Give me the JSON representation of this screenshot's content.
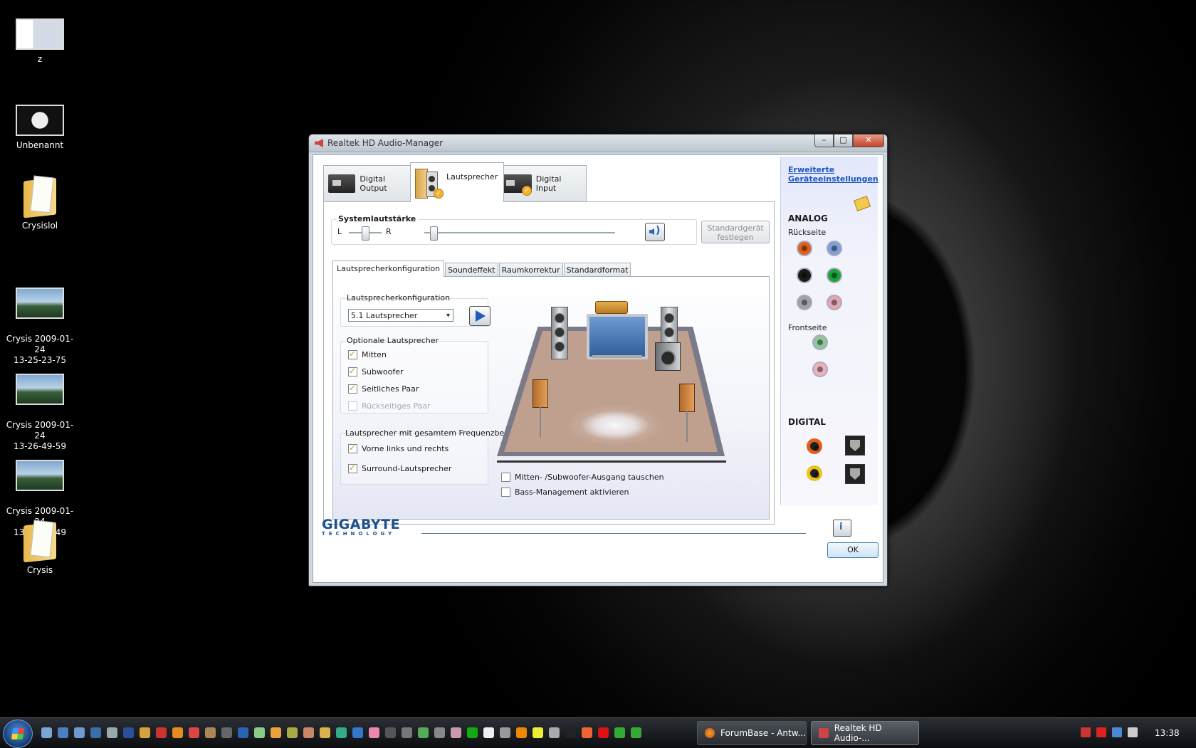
{
  "desktop": {
    "icons": [
      {
        "label": "z"
      },
      {
        "label": "Unbenannt"
      },
      {
        "label": "Crysislol"
      },
      {
        "label": "Crysis 2009-01-24\n13-25-23-75"
      },
      {
        "label": "Crysis 2009-01-24\n13-26-49-59"
      },
      {
        "label": "Crysis 2009-01-24\n13-26-50-49"
      },
      {
        "label": "Crysis"
      }
    ]
  },
  "window": {
    "title": "Realtek HD Audio-Manager",
    "buttons": {
      "minimize": "–",
      "maximize": "□",
      "close": "✕"
    }
  },
  "device_tabs": [
    {
      "label": "Digital Output",
      "icon": "sound-card-icon",
      "active": false
    },
    {
      "label": "Lautsprecher",
      "icon": "speaker-icon",
      "active": true
    },
    {
      "label": "Digital Input",
      "icon": "sound-card-input-icon",
      "active": false
    }
  ],
  "volume": {
    "title": "Systemlautstärke",
    "left_label": "L",
    "right_label": "R",
    "balance_level": 0.5,
    "volume_level": 0.05,
    "mute_icon": "speaker-volume-icon",
    "default_device_button": "Standardgerät\nfestlegen"
  },
  "sub_tabs": [
    {
      "label": "Lautsprecherkonfiguration",
      "active": true
    },
    {
      "label": "Soundeffekt",
      "active": false
    },
    {
      "label": "Raumkorrektur",
      "active": false
    },
    {
      "label": "Standardformat",
      "active": false
    }
  ],
  "config": {
    "group_title": "Lautsprecherkonfiguration",
    "selected": "5.1 Lautsprecher",
    "play_icon": "play-icon"
  },
  "optional": {
    "title": "Optionale Lautsprecher",
    "items": [
      {
        "label": "Mitten",
        "checked": true,
        "disabled": false
      },
      {
        "label": "Subwoofer",
        "checked": true,
        "disabled": false
      },
      {
        "label": "Seitliches Paar",
        "checked": true,
        "disabled": false
      },
      {
        "label": "Rückseitiges Paar",
        "checked": false,
        "disabled": true
      }
    ]
  },
  "fullrange": {
    "title": "Lautsprecher mit gesamtem Frequenzbereich",
    "items": [
      {
        "label": "Vorne links und rechts",
        "checked": true
      },
      {
        "label": "Surround-Lautsprecher",
        "checked": true
      }
    ]
  },
  "bottom_options": [
    {
      "label": "Mitten- /Subwoofer-Ausgang tauschen",
      "checked": false
    },
    {
      "label": "Bass-Management aktivieren",
      "checked": false
    }
  ],
  "right_panel": {
    "link": "Erweiterte\nGeräteeinstellungen",
    "analog_title": "ANALOG",
    "back_label": "Rückseite",
    "front_label": "Frontseite",
    "digital_title": "DIGITAL",
    "back_jacks": [
      "#e0601b",
      "#7b9fd6",
      "#1b1b1b",
      "#1aa33a",
      "#9ea3a8",
      "#e4a6b4"
    ],
    "front_jacks": [
      "#8fc79c",
      "#ecb2bd"
    ],
    "digital_jacks": [
      "#e0601b",
      "#e8c51c"
    ]
  },
  "footer": {
    "brand": "GIGABYTE",
    "brand_sub": "TECHNOLOGY",
    "ok": "OK"
  },
  "taskbar": {
    "tasks": [
      {
        "label": "ForumBase - Antw...",
        "icon": "firefox-icon",
        "active": false
      },
      {
        "label": "Realtek HD Audio-...",
        "icon": "realtek-icon",
        "active": true
      }
    ],
    "clock": "13:38"
  }
}
